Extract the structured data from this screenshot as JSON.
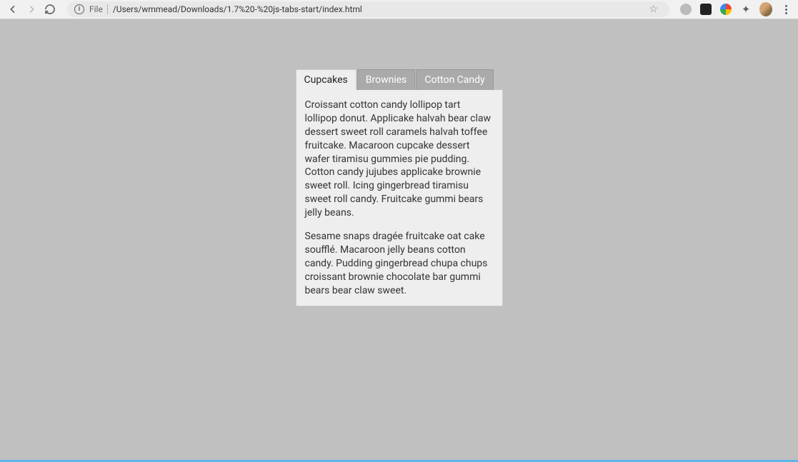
{
  "browser": {
    "file_label": "File",
    "url": "/Users/wmmead/Downloads/1.7%20-%20js-tabs-start/index.html"
  },
  "tabs": {
    "items": [
      {
        "label": "Cupcakes",
        "active": true
      },
      {
        "label": "Brownies",
        "active": false
      },
      {
        "label": "Cotton Candy",
        "active": false
      }
    ]
  },
  "content": {
    "paragraph1": "Croissant cotton candy lollipop tart lollipop donut. Applicake halvah bear claw dessert sweet roll caramels halvah toffee fruitcake. Macaroon cupcake dessert wafer tiramisu gummies pie pudding. Cotton candy jujubes applicake brownie sweet roll. Icing gingerbread tiramisu sweet roll candy. Fruitcake gummi bears jelly beans.",
    "paragraph2": "Sesame snaps dragée fruitcake oat cake soufflé. Macaroon jelly beans cotton candy. Pudding gingerbread chupa chups croissant brownie chocolate bar gummi bears bear claw sweet."
  }
}
